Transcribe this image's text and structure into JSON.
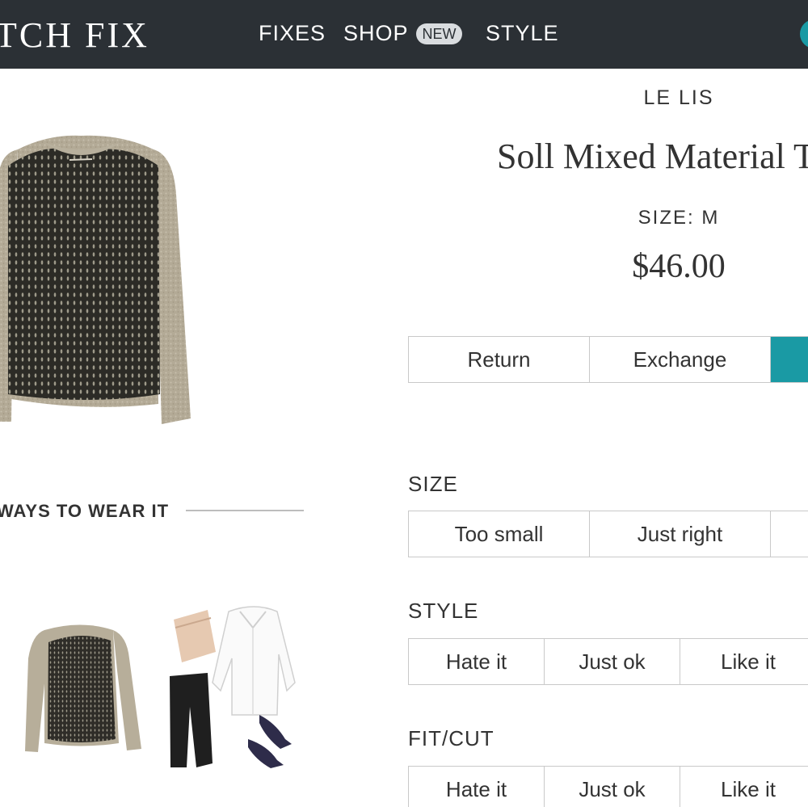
{
  "header": {
    "logo": "TCH FIX",
    "nav": {
      "fixes": "FIXES",
      "shop": "SHOP",
      "shop_badge": "NEW",
      "style": "STYLE"
    }
  },
  "product": {
    "brand": "LE LIS",
    "name": "Soll Mixed Material T",
    "size": "SIZE: M",
    "price": "$46.00"
  },
  "actions": {
    "return": "Return",
    "exchange": "Exchange"
  },
  "ways_to_wear": {
    "heading": "WAYS TO WEAR IT"
  },
  "feedback": {
    "size": {
      "label": "SIZE",
      "options": [
        "Too small",
        "Just right"
      ]
    },
    "style": {
      "label": "STYLE",
      "options": [
        "Hate it",
        "Just ok",
        "Like it"
      ]
    },
    "fit": {
      "label": "FIT/CUT",
      "options": [
        "Hate it",
        "Just ok",
        "Like it"
      ]
    }
  },
  "colors": {
    "topbar": "#2b3035",
    "accent": "#1a9aa4",
    "border": "#c9c9c9"
  }
}
